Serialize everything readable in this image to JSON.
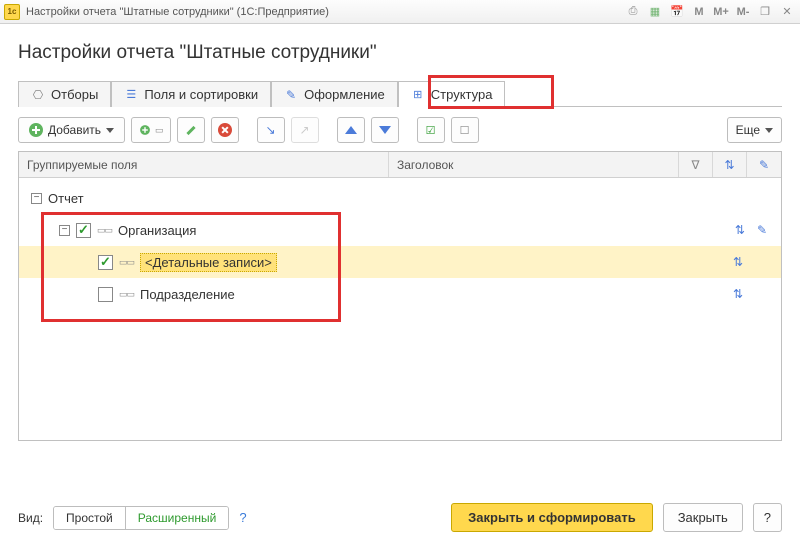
{
  "window": {
    "title": "Настройки отчета \"Штатные сотрудники\"  (1С:Предприятие)",
    "mem_buttons": [
      "M",
      "M+",
      "M-"
    ]
  },
  "page_title": "Настройки отчета \"Штатные сотрудники\"",
  "tabs": [
    {
      "label": "Отборы",
      "icon": "funnel-icon"
    },
    {
      "label": "Поля и сортировки",
      "icon": "fields-icon"
    },
    {
      "label": "Оформление",
      "icon": "brush-icon"
    },
    {
      "label": "Структура",
      "icon": "tree-icon",
      "active": true,
      "highlighted": true
    }
  ],
  "toolbar": {
    "add_label": "Добавить",
    "more_label": "Еще"
  },
  "columns": {
    "group_fields": "Группируемые поля",
    "title": "Заголовок"
  },
  "tree": [
    {
      "level": 0,
      "expander": "-",
      "checkbox": null,
      "label": "Отчет",
      "actions": []
    },
    {
      "level": 1,
      "expander": "-",
      "checkbox": true,
      "label": "Организация",
      "actions": [
        "sort",
        "brush"
      ]
    },
    {
      "level": 2,
      "expander": null,
      "checkbox": true,
      "label": "<Детальные записи>",
      "highlighted": true,
      "actions": [
        "sort"
      ]
    },
    {
      "level": 2,
      "expander": null,
      "checkbox": false,
      "label": "Подразделение",
      "actions": [
        "sort"
      ]
    }
  ],
  "footer": {
    "vid_label": "Вид:",
    "simple": "Простой",
    "advanced": "Расширенный",
    "close_and_generate": "Закрыть и сформировать",
    "close": "Закрыть",
    "help": "?"
  }
}
